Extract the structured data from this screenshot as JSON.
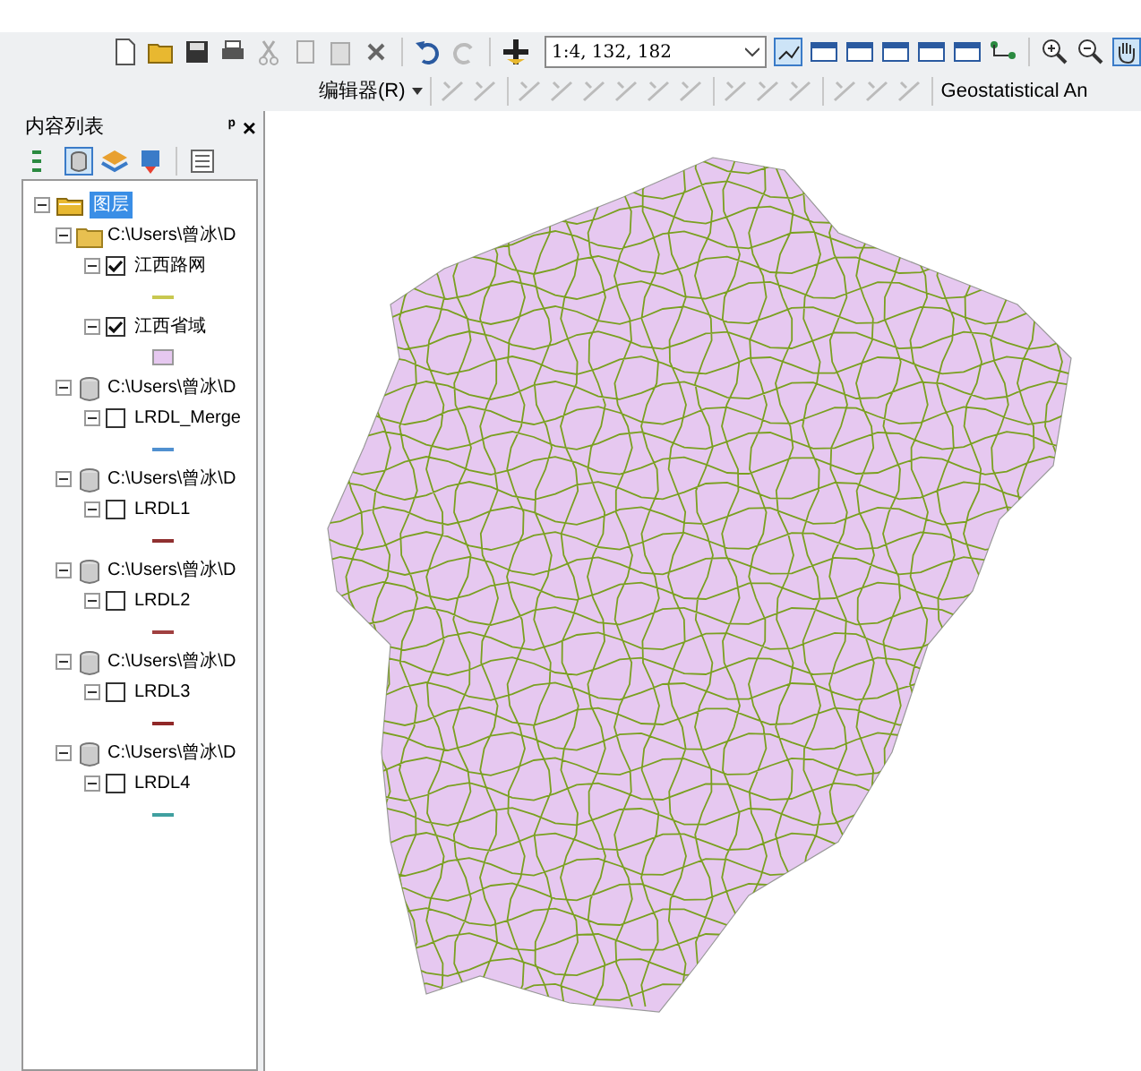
{
  "toolbar": {
    "scale": "1:4, 132, 182",
    "editor_menu": "编辑器(R)",
    "geostatistical": "Geostatistical An"
  },
  "toc": {
    "title": "内容列表",
    "pin": "ᵖ",
    "close": "×",
    "root": {
      "label": "图层",
      "selected": true,
      "expanded": true,
      "groups": [
        {
          "path": "C:\\Users\\曾冰\\D",
          "kind": "folder",
          "expanded": true,
          "layers": [
            {
              "name": "江西路网",
              "checked": true,
              "kind": "line",
              "color": "#c8c850"
            },
            {
              "name": "江西省域",
              "checked": true,
              "kind": "polygon",
              "color": "#e6c8f0"
            }
          ]
        },
        {
          "path": "C:\\Users\\曾冰\\D",
          "kind": "database",
          "expanded": true,
          "layers": [
            {
              "name": "LRDL_Merge",
              "checked": false,
              "kind": "line",
              "color": "#5090d0"
            }
          ]
        },
        {
          "path": "C:\\Users\\曾冰\\D",
          "kind": "database",
          "expanded": true,
          "layers": [
            {
              "name": "LRDL1",
              "checked": false,
              "kind": "line",
              "color": "#903030"
            }
          ]
        },
        {
          "path": "C:\\Users\\曾冰\\D",
          "kind": "database",
          "expanded": true,
          "layers": [
            {
              "name": "LRDL2",
              "checked": false,
              "kind": "line",
              "color": "#a04040"
            }
          ]
        },
        {
          "path": "C:\\Users\\曾冰\\D",
          "kind": "database",
          "expanded": true,
          "layers": [
            {
              "name": "LRDL3",
              "checked": false,
              "kind": "line",
              "color": "#902828"
            }
          ]
        },
        {
          "path": "C:\\Users\\曾冰\\D",
          "kind": "database",
          "expanded": true,
          "layers": [
            {
              "name": "LRDL4",
              "checked": false,
              "kind": "line",
              "color": "#40a0a0"
            }
          ]
        }
      ]
    }
  }
}
